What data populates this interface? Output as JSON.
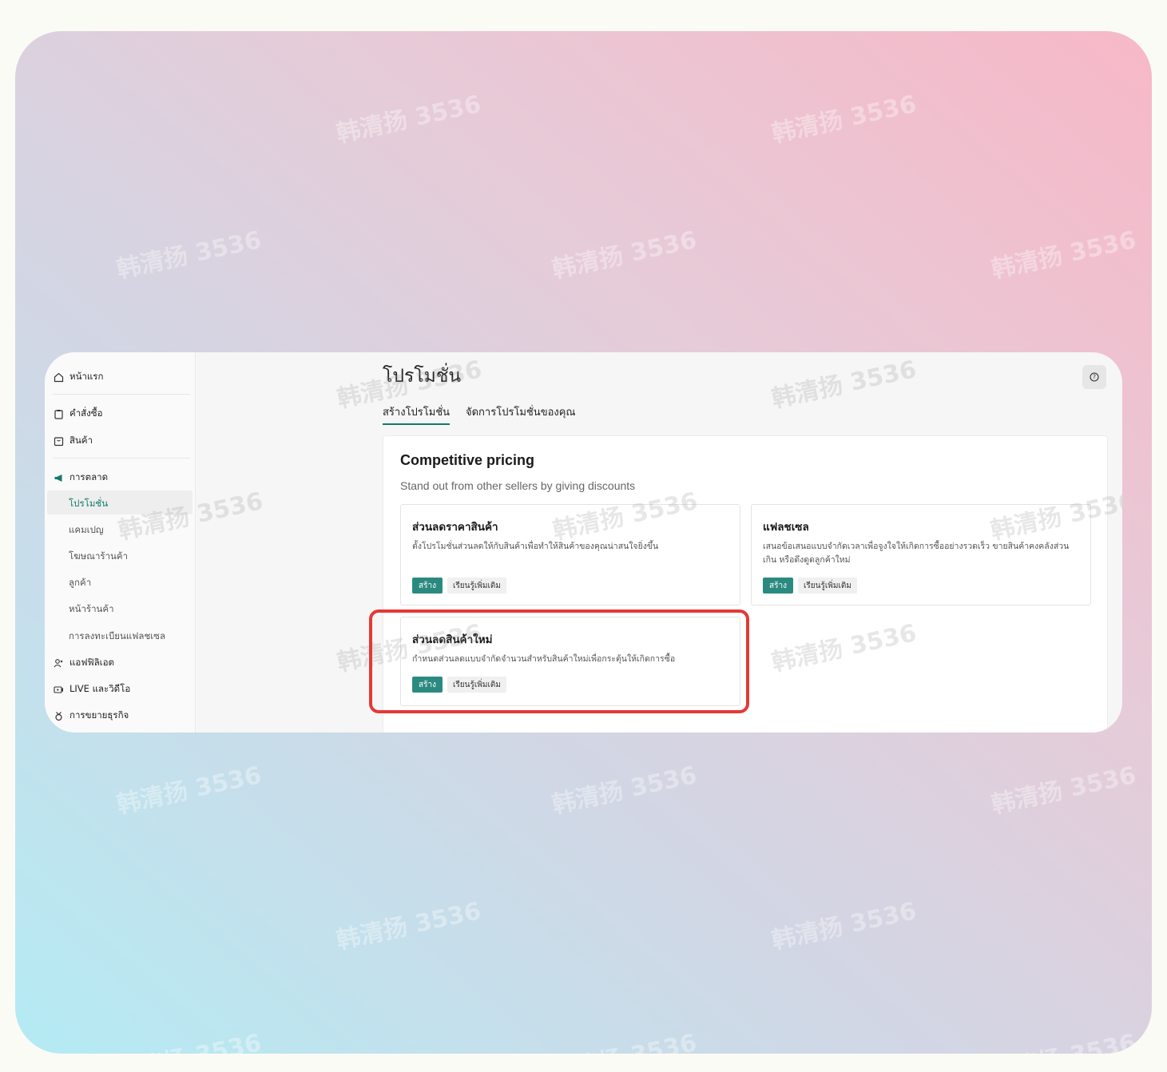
{
  "watermark": "韩清扬 3536",
  "sidebar": {
    "home": "หน้าแรก",
    "orders": "คำสั่งซื้อ",
    "products": "สินค้า",
    "marketing": "การตลาด",
    "marketing_items": [
      "โปรโมชั่น",
      "แคมเปญ",
      "โฆษณาร้านค้า",
      "ลูกค้า",
      "หน้าร้านค้า",
      "การลงทะเบียนแฟลชเซล"
    ],
    "affiliate": "แอฟฟิลิเอต",
    "live_video": "LIVE และวิดีโอ",
    "growth": "การขยายธุรกิจ"
  },
  "header": {
    "title": "โปรโมชั่น",
    "help_icon": "?"
  },
  "tabs": [
    "สร้างโปรโมชั่น",
    "จัดการโปรโมชั่นของคุณ"
  ],
  "section": {
    "title": "Competitive pricing",
    "subtitle": "Stand out from other sellers by giving discounts"
  },
  "cards": [
    {
      "title": "ส่วนลดราคาสินค้า",
      "desc": "ตั้งโปรโมชั่นส่วนลดให้กับสินค้าเพื่อทำให้สินค้าของคุณน่าสนใจยิ่งขึ้น",
      "create": "สร้าง",
      "learn": "เรียนรู้เพิ่มเติม"
    },
    {
      "title": "แฟลชเซล",
      "desc": "เสนอข้อเสนอแบบจำกัดเวลาเพื่อจูงใจให้เกิดการซื้ออย่างรวดเร็ว ขายสินค้าคงคลังส่วนเกิน หรือดึงดูดลูกค้าใหม่",
      "create": "สร้าง",
      "learn": "เรียนรู้เพิ่มเติม"
    },
    {
      "title": "ส่วนลดสินค้าใหม่",
      "desc": "กำหนดส่วนลดแบบจำกัดจำนวนสำหรับสินค้าใหม่เพื่อกระตุ้นให้เกิดการซื้อ",
      "create": "สร้าง",
      "learn": "เรียนรู้เพิ่มเติม"
    }
  ],
  "colors": {
    "accent": "#0f7b6c",
    "button": "#2b8a80",
    "highlight": "#e53935"
  }
}
